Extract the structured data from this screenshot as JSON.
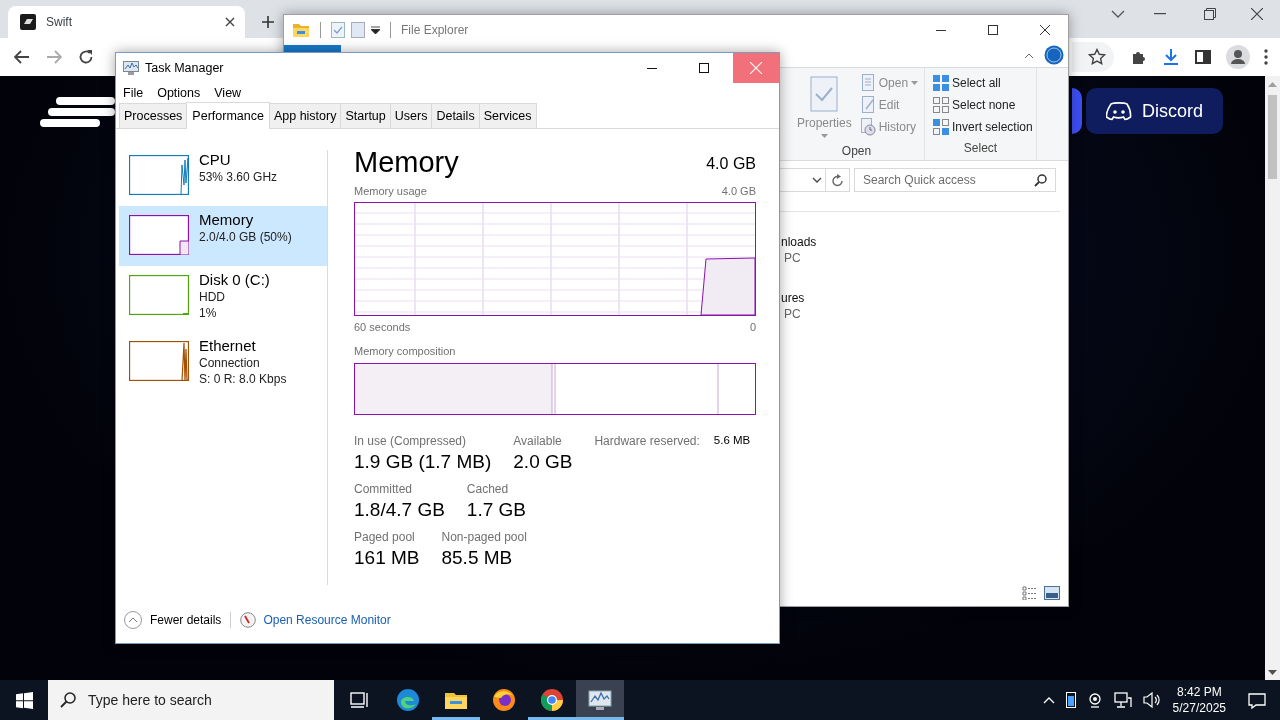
{
  "browser": {
    "tab_title": "Swift",
    "page_buttons": [
      {
        "label": "Discord",
        "kind": "discord"
      }
    ]
  },
  "file_explorer": {
    "title": "File Explorer",
    "ribbon_groups": [
      {
        "label": "Open",
        "items": [
          {
            "label": "Properties",
            "kind": "large",
            "dropdown": true,
            "disabled": true
          },
          {
            "label": "Open",
            "kind": "small",
            "dropdown": true,
            "disabled": true
          },
          {
            "label": "Edit",
            "kind": "small",
            "dropdown": false,
            "disabled": true
          },
          {
            "label": "History",
            "kind": "small",
            "dropdown": false,
            "disabled": true
          }
        ]
      },
      {
        "label": "Select",
        "items": [
          {
            "label": "Select all",
            "kind": "small",
            "dropdown": false,
            "disabled": false
          },
          {
            "label": "Select none",
            "kind": "small",
            "dropdown": false,
            "disabled": false
          },
          {
            "label": "Invert selection",
            "kind": "small",
            "dropdown": false,
            "disabled": false
          }
        ]
      }
    ],
    "search": {
      "placeholder": "Search Quick access"
    },
    "items": [
      {
        "name": "nloads",
        "location": "PC"
      },
      {
        "name": "ures",
        "location": "PC"
      }
    ]
  },
  "task_manager": {
    "title": "Task Manager",
    "menu": [
      "File",
      "Options",
      "View"
    ],
    "tabs": [
      {
        "label": "Processes",
        "selected": false
      },
      {
        "label": "Performance",
        "selected": true
      },
      {
        "label": "App history",
        "selected": false
      },
      {
        "label": "Startup",
        "selected": false
      },
      {
        "label": "Users",
        "selected": false
      },
      {
        "label": "Details",
        "selected": false
      },
      {
        "label": "Services",
        "selected": false
      }
    ],
    "resources": [
      {
        "name": "CPU",
        "lines": [
          "53%  3.60 GHz"
        ],
        "kind": "cpu",
        "color": "#117dbb",
        "selected": false
      },
      {
        "name": "Memory",
        "lines": [
          "2.0/4.0 GB (50%)"
        ],
        "kind": "memory",
        "color": "#8b12ae",
        "selected": true
      },
      {
        "name": "Disk 0 (C:)",
        "lines": [
          "HDD",
          "1%"
        ],
        "kind": "disk",
        "color": "#4da60c",
        "selected": false
      },
      {
        "name": "Ethernet",
        "lines": [
          "Connection",
          "S: 0 R: 8.0 Kbps"
        ],
        "kind": "network",
        "color": "#a74f01",
        "selected": false
      }
    ],
    "detail": {
      "title": "Memory",
      "total": "4.0 GB",
      "usage_label": "Memory usage",
      "usage_max": "4.0 GB",
      "time_label": "60 seconds",
      "time_end": "0",
      "composition_label": "Memory composition",
      "stats": [
        [
          {
            "label": "In use (Compressed)",
            "value": "1.9 GB (1.7 MB)",
            "kind": "big"
          },
          {
            "label": "Available",
            "value": "2.0 GB",
            "kind": "big"
          },
          {
            "label": "Hardware reserved:",
            "value": "5.6 MB",
            "kind": "inline"
          }
        ],
        [
          {
            "label": "Committed",
            "value": "1.8/4.7 GB",
            "kind": "big"
          },
          {
            "label": "Cached",
            "value": "1.7 GB",
            "kind": "big"
          }
        ],
        [
          {
            "label": "Paged pool",
            "value": "161 MB",
            "kind": "big"
          },
          {
            "label": "Non-paged pool",
            "value": "85.5 MB",
            "kind": "big"
          }
        ]
      ]
    },
    "footer": {
      "toggle": "Fewer details",
      "link": "Open Resource Monitor"
    }
  },
  "taskbar": {
    "search_placeholder": "Type here to search",
    "apps": [
      {
        "kind": "edge",
        "running": false,
        "selected": false
      },
      {
        "kind": "explorer",
        "running": true,
        "selected": false
      },
      {
        "kind": "firefox",
        "running": false,
        "selected": false
      },
      {
        "kind": "chrome",
        "running": true,
        "selected": false
      },
      {
        "kind": "taskmanager",
        "running": true,
        "selected": true
      }
    ],
    "time": "8:42 PM",
    "date": "5/27/2025"
  }
}
